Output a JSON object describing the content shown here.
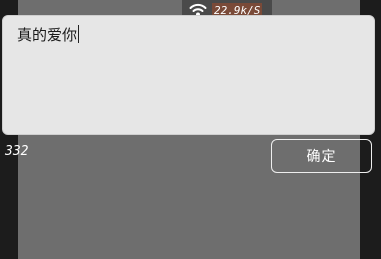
{
  "status_bar": {
    "wifi_icon": "wifi-icon",
    "net_speed": "22.9k/S"
  },
  "editor": {
    "value": "真的爱你"
  },
  "footer": {
    "char_count": "332",
    "confirm_label": "确定"
  },
  "colors": {
    "input_background": "#e6e6e6",
    "backdrop": "#6e6e6e",
    "page_background": "#1c1c1c",
    "speed_highlight": "#7a4a38"
  }
}
